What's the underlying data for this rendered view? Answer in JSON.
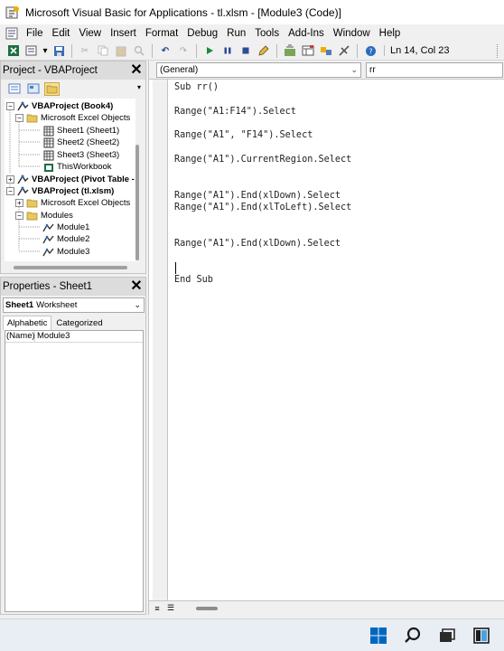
{
  "window": {
    "title": "Microsoft Visual Basic for Applications - tl.xlsm - [Module3 (Code)]"
  },
  "menu": [
    "File",
    "Edit",
    "View",
    "Insert",
    "Format",
    "Debug",
    "Run",
    "Tools",
    "Add-Ins",
    "Window",
    "Help"
  ],
  "toolbar": {
    "position": "Ln 14, Col 23"
  },
  "project_panel": {
    "title": "Project - VBAProject",
    "tree": [
      {
        "label": "VBAProject (Book4)",
        "bold": true
      },
      {
        "label": "Microsoft Excel Objects"
      },
      {
        "label": "Sheet1 (Sheet1)"
      },
      {
        "label": "Sheet2 (Sheet2)"
      },
      {
        "label": "Sheet3 (Sheet3)"
      },
      {
        "label": "ThisWorkbook"
      },
      {
        "label": "VBAProject (Pivot Table -",
        "bold": true
      },
      {
        "label": "VBAProject (tl.xlsm)",
        "bold": true
      },
      {
        "label": "Microsoft Excel Objects"
      },
      {
        "label": "Modules"
      },
      {
        "label": "Module1"
      },
      {
        "label": "Module2"
      },
      {
        "label": "Module3"
      }
    ]
  },
  "properties_panel": {
    "title": "Properties - Sheet1",
    "object_name": "Sheet1",
    "object_type": "Worksheet",
    "tabs": [
      "Alphabetic",
      "Categorized"
    ],
    "row": {
      "key": "(Name)",
      "value": "Module3"
    }
  },
  "code_window": {
    "object_combo": "(General)",
    "proc_combo": "rr",
    "lines": [
      "Sub rr()",
      "Range(\"A1:F14\").Select",
      "Range(\"A1\", \"F14\").Select",
      "Range(\"A1\").CurrentRegion.Select",
      "Range(\"A1\").End(xlDown).Select",
      "Range(\"A1\").End(xlToLeft).Select",
      "Range(\"A1\").End(xlDown).Select",
      "End Sub"
    ]
  },
  "colors": {
    "titlebar": "#ffffff",
    "chrome": "#f0f0f0",
    "panel_header": "#dcdcdc",
    "taskbar": "#e9eef4",
    "accent": "#0067c0"
  }
}
